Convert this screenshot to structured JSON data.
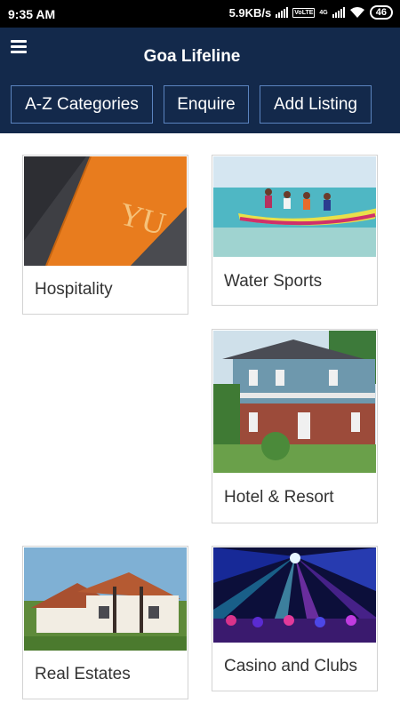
{
  "status": {
    "time": "9:35 AM",
    "speed": "5.9KB/s",
    "volte": "VoLTE",
    "net": "4G",
    "battery": "46"
  },
  "header": {
    "title": "Goa Lifeline"
  },
  "actions": {
    "categories": "A-Z Categories",
    "enquire": "Enquire",
    "add": "Add Listing"
  },
  "categories": [
    {
      "label": "Hospitality"
    },
    {
      "label": "Water Sports"
    },
    {
      "label": "Hotel & Resort"
    },
    {
      "label": "Real Estates"
    },
    {
      "label": "Casino and Clubs"
    }
  ],
  "colors": {
    "appbar": "#13294b",
    "button_border": "#5b84bf",
    "card_border": "#d3d3d3",
    "label": "#333333"
  }
}
